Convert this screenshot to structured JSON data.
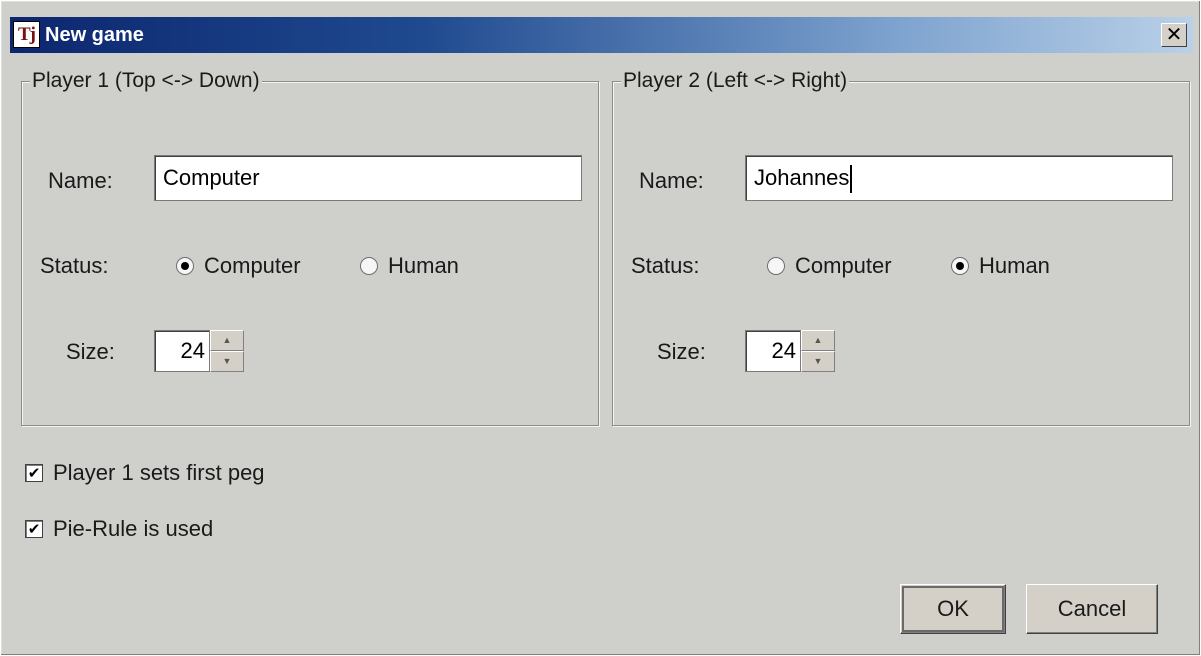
{
  "window": {
    "title": "New game",
    "icon_text": "Tj",
    "close_label": "✕"
  },
  "player1": {
    "legend": "Player 1 (Top <-> Down)",
    "name_label": "Name:",
    "name_value": "Computer",
    "status_label": "Status:",
    "status_options": [
      "Computer",
      "Human"
    ],
    "status_selected": "Computer",
    "size_label": "Size:",
    "size_value": "24"
  },
  "player2": {
    "legend": "Player 2 (Left <-> Right)",
    "name_label": "Name:",
    "name_value": "Johannes",
    "status_label": "Status:",
    "status_options": [
      "Computer",
      "Human"
    ],
    "status_selected": "Human",
    "size_label": "Size:",
    "size_value": "24"
  },
  "options": {
    "first_peg": {
      "label": "Player 1 sets first peg",
      "checked": true
    },
    "pie_rule": {
      "label": "Pie-Rule is used",
      "checked": true
    }
  },
  "buttons": {
    "ok": "OK",
    "cancel": "Cancel"
  }
}
